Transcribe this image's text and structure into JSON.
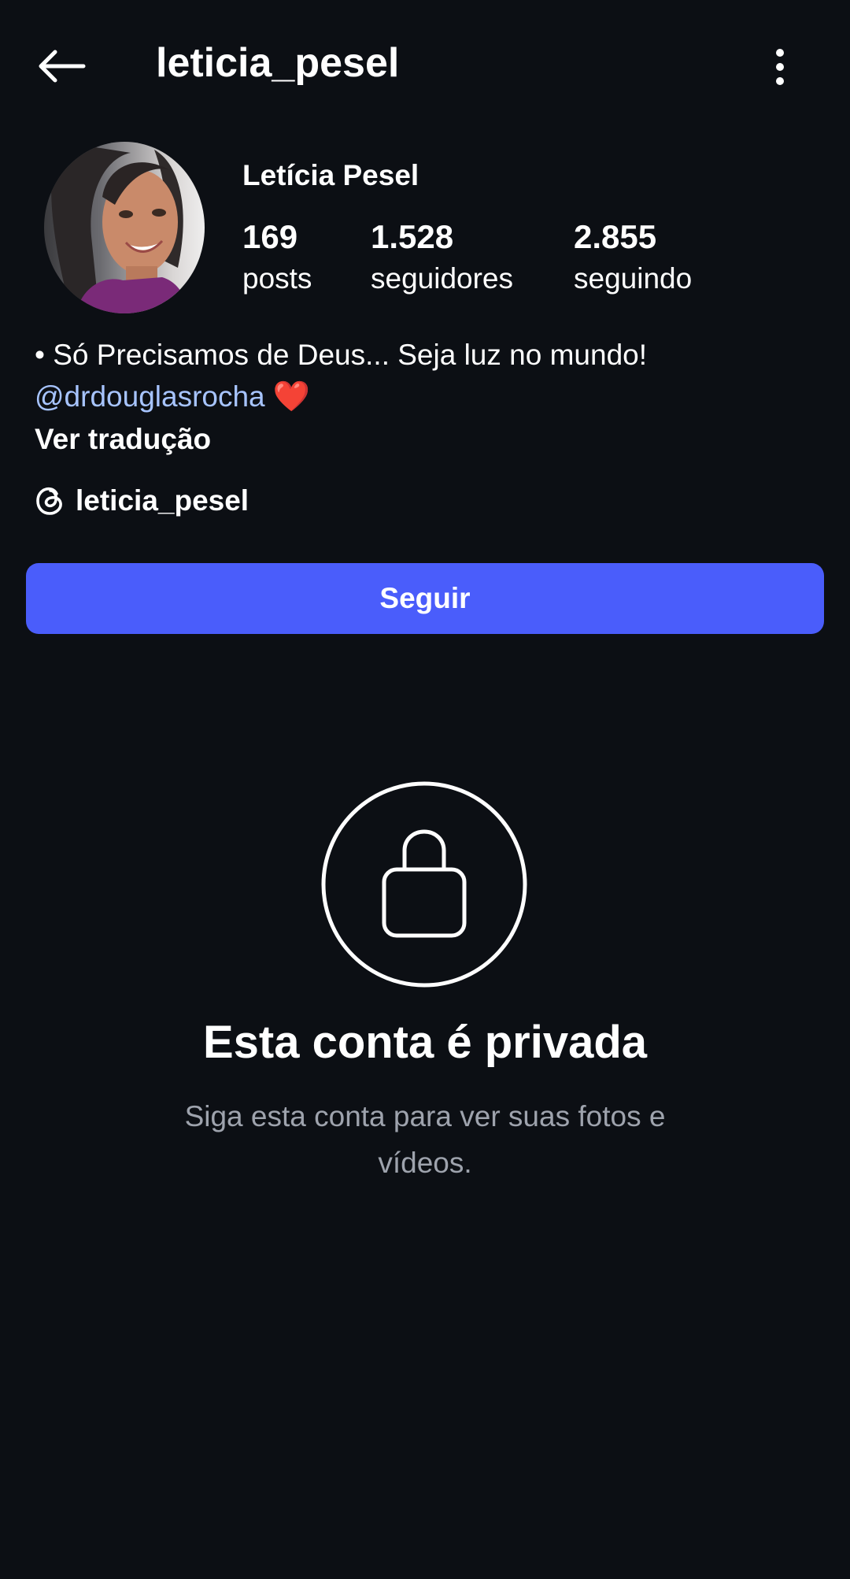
{
  "header": {
    "username": "leticia_pesel",
    "back_icon": "arrow-left-icon",
    "more_icon": "more-vertical-icon"
  },
  "profile": {
    "display_name": "Letícia Pesel",
    "avatar_icon": "profile-photo",
    "stats": [
      {
        "value": "169",
        "label": "posts"
      },
      {
        "value": "1.528",
        "label": "seguidores"
      },
      {
        "value": "2.855",
        "label": "seguindo"
      }
    ],
    "bio": {
      "line1": "• Só Precisamos de Deus... Seja luz no mundo!",
      "mention": "@drdouglasrocha",
      "heart": "❤️",
      "translate": "Ver tradução"
    },
    "threads": {
      "icon": "threads-icon",
      "handle": "leticia_pesel"
    }
  },
  "actions": {
    "follow_label": "Seguir"
  },
  "private_notice": {
    "icon": "lock-icon",
    "title": "Esta conta é privada",
    "subtitle": "Siga esta conta para ver suas fotos e vídeos."
  },
  "colors": {
    "background": "#0c0f14",
    "accent": "#4a5dfb",
    "mention": "#a7c4ff",
    "muted": "#9ea3ad"
  }
}
